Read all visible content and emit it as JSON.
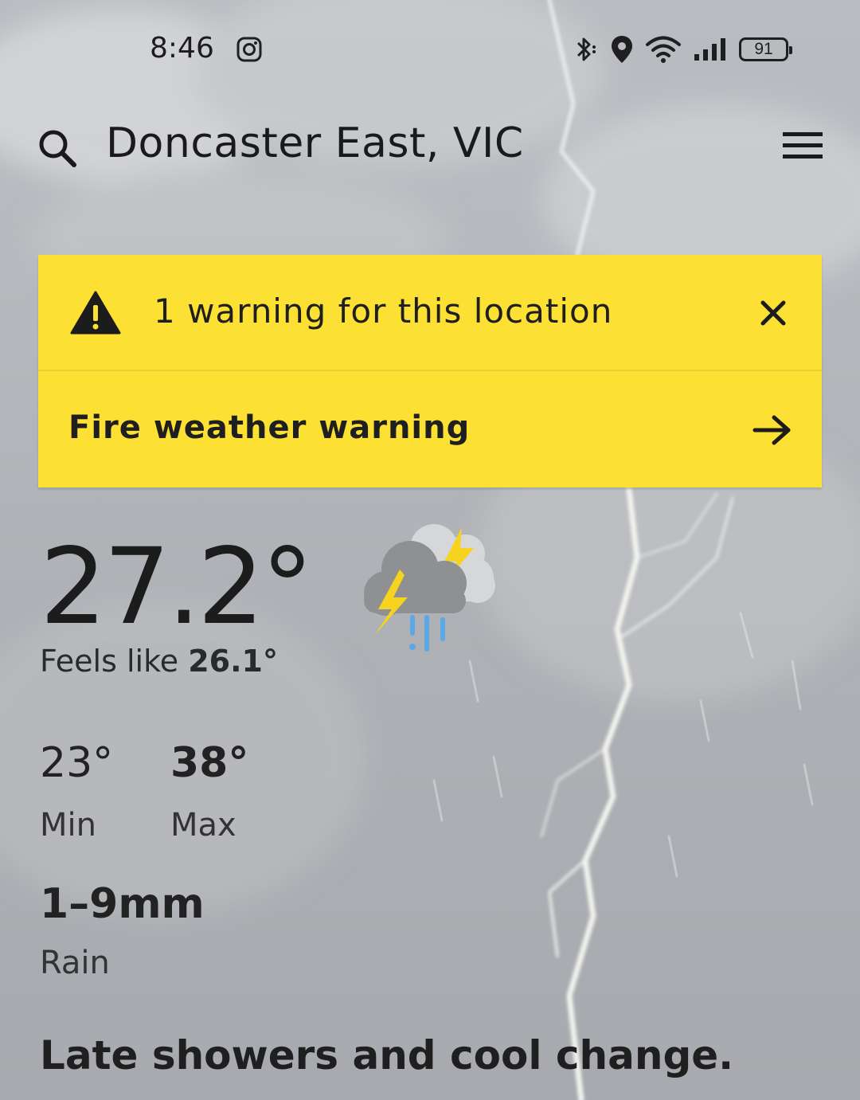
{
  "status_bar": {
    "time": "8:46",
    "battery": "91"
  },
  "header": {
    "location": "Doncaster East, VIC"
  },
  "warnings": {
    "count_text": "1 warning for this location",
    "items": [
      {
        "title": "Fire weather warning"
      }
    ]
  },
  "current": {
    "temperature": "27.2°",
    "feels_like_label": "Feels like",
    "feels_like_value": "26.1°",
    "min_value": "23°",
    "min_label": "Min",
    "max_value": "38°",
    "max_label": "Max",
    "rain_value": "1–9mm",
    "rain_label": "Rain",
    "summary": "Late showers and cool change.",
    "icon": "storm-rain-icon"
  },
  "colors": {
    "warning_bg": "#fce033",
    "background": "#b3b6ba",
    "bolt": "#f6d31e",
    "rain": "#5aa9e6"
  }
}
